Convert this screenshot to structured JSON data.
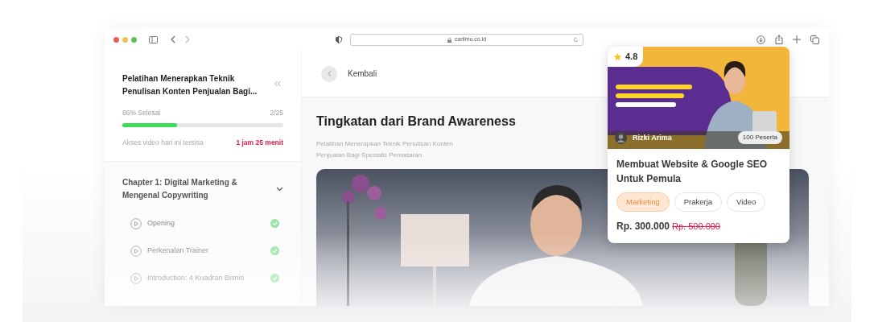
{
  "browser": {
    "url": "carilmu.co.id"
  },
  "sidebar": {
    "course_title": "Pelatihan Menerapkan Teknik Penulisan Konten Penjualan Bagi...",
    "progress_label": "86% Selesai",
    "progress_count": "2/25",
    "level": 0.34,
    "access_label": "Akses video hari ini tersisa",
    "access_time": "1 jam 25 menit",
    "chapters": [
      {
        "title": "Chapter 1: Digital Marketing & Mengenal Copywriting",
        "expanded": true,
        "lessons": [
          {
            "title": "Opening",
            "completed": true
          },
          {
            "title": "Perkenalan Trainer",
            "completed": true
          },
          {
            "title": "Introduction: 4 Kuadran Bisnis",
            "completed": true
          }
        ]
      }
    ]
  },
  "main": {
    "back_label": "Kembali",
    "lesson_title": "Tingkatan dari Brand Awareness",
    "course_name": "Pelatihan Menerapkan Teknik Penulisan Konten Penjualan Bagi Spesialis Pemasaran"
  },
  "card": {
    "rating": "4.8",
    "instructor": "Rizki Arima",
    "participants": "100 Peserta",
    "title": "Membuat Website & Google SEO Untuk Pemula",
    "tags": [
      {
        "label": "Marketing",
        "selected": true
      },
      {
        "label": "Prakerja",
        "selected": false
      },
      {
        "label": "Video",
        "selected": false
      }
    ],
    "price": "Rp. 300.000",
    "old_price": "Rp. 500.000"
  }
}
